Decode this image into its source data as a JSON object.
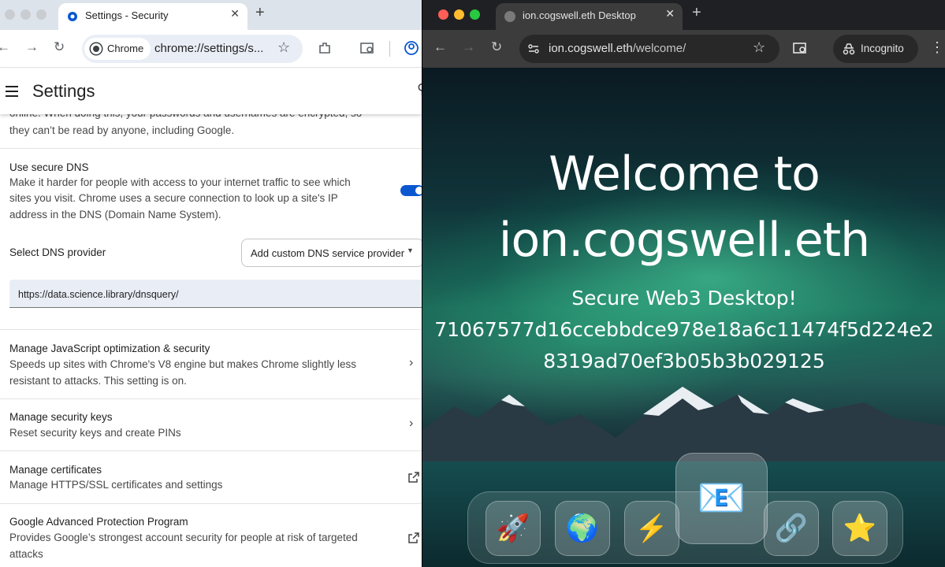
{
  "left_window": {
    "tab_title": "Settings - Security",
    "address_chip": "Chrome",
    "url": "chrome://settings/s...",
    "page_title": "Settings",
    "truncated_text": {
      "line1": "online. When doing this, your passwords and usernames are encrypted, so",
      "line2": "they can’t be read by anyone, including Google."
    },
    "secure_dns": {
      "title": "Use secure DNS",
      "desc1": "Make it harder for people with access to your internet traffic to see which",
      "desc2": "sites you visit. Chrome uses a secure connection to look up a site's IP",
      "desc3": "address in the DNS (Domain Name System).",
      "enabled": true
    },
    "dns_provider": {
      "label": "Select DNS provider",
      "selected": "Add custom DNS service provider",
      "custom_value": "https://data.science.library/dnsquery/"
    },
    "js_optimization": {
      "title": "Manage JavaScript optimization & security",
      "desc1": "Speeds up sites with Chrome's V8 engine but makes Chrome slightly less",
      "desc2": "resistant to attacks. This setting is on."
    },
    "security_keys": {
      "title": "Manage security keys",
      "desc": "Reset security keys and create PINs"
    },
    "certificates": {
      "title": "Manage certificates",
      "desc": "Manage HTTPS/SSL certificates and settings"
    },
    "advanced_protection": {
      "title": "Google Advanced Protection Program",
      "desc1": "Provides Google’s strongest account security for people at risk of targeted",
      "desc2": "attacks"
    }
  },
  "right_window": {
    "tab_title": "ion.cogswell.eth Desktop",
    "url_host": "ion.cogswell.eth",
    "url_path": "/welcome/",
    "incognito_label": "Incognito",
    "heading_line1": "Welcome to",
    "heading_line2": "ion.cogswell.eth",
    "subtitle": "Secure Web3 Desktop!",
    "hash_line1": "71067577d16ccebbdce978e18a6c11474f5d224e2",
    "hash_line2": "8319ad70ef3b05b3b029125",
    "dock": [
      {
        "icon": "🚀",
        "name": "rocket-icon"
      },
      {
        "icon": "🌍",
        "name": "globe-icon"
      },
      {
        "icon": "⚡",
        "name": "lightning-icon"
      },
      {
        "icon": "📧",
        "name": "email-icon"
      },
      {
        "icon": "🔗",
        "name": "link-icon"
      },
      {
        "icon": "⭐",
        "name": "star-icon"
      }
    ]
  },
  "colors": {
    "toggle_on": "#0b57d0",
    "left_tabstrip": "#dde3ea",
    "right_toolbar": "#3c3c3c"
  }
}
